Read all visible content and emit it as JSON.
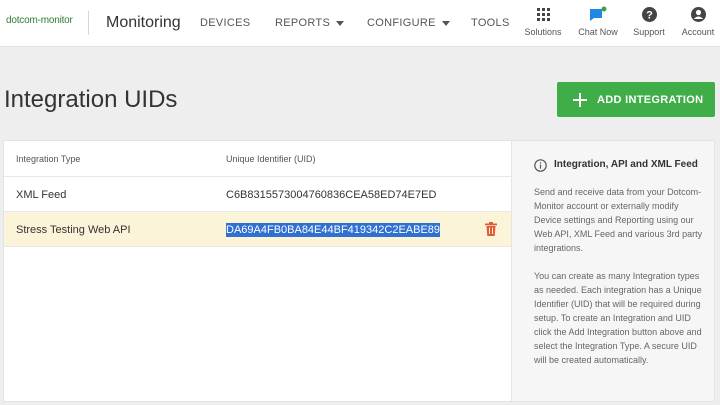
{
  "header": {
    "logo": "dotcom-monitor",
    "app_title": "Monitoring",
    "nav": [
      {
        "label": "DEVICES"
      },
      {
        "label": "REPORTS"
      },
      {
        "label": "CONFIGURE"
      },
      {
        "label": "TOOLS"
      }
    ],
    "right": {
      "solutions": "Solutions",
      "chat": "Chat Now",
      "support": "Support",
      "account": "Account"
    }
  },
  "page": {
    "title": "Integration UIDs",
    "add_button": "ADD INTEGRATION"
  },
  "table": {
    "columns": [
      "Integration Type",
      "Unique Identifier (UID)"
    ],
    "rows": [
      {
        "type": "XML Feed",
        "uid": "C6B8315573004760836CEA58ED74E7ED"
      },
      {
        "type": "Stress Testing Web API",
        "uid": "DA69A4FB0BA84E44BF419342C2EABE89"
      }
    ]
  },
  "side_panel": {
    "title": "Integration, API and XML Feed",
    "p1": "Send and receive data from your Dotcom-Monitor account or externally modify Device settings and Reporting using our Web API, XML Feed and various 3rd party integrations.",
    "p2": "You can create as many Integration types as needed. Each integration has a Unique Identifier (UID) that will be required during setup. To create an Integration and UID click the Add Integration button above and select the Integration Type. A secure UID will be created automatically."
  },
  "colors": {
    "accent_green": "#3fae49",
    "selection_blue": "#2f70d0",
    "row_highlight": "#fcf4d8",
    "delete_red": "#e25a3a"
  }
}
